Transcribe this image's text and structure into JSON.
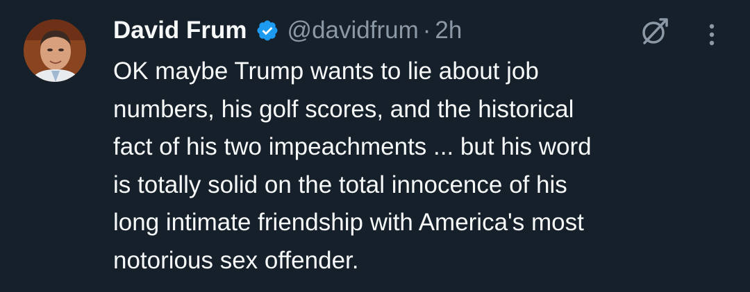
{
  "author": {
    "name": "David Frum",
    "handle": "@davidfrum",
    "separator": "·",
    "time": "2h",
    "verified": true
  },
  "tweet": {
    "lines": [
      "OK maybe Trump wants to lie about job",
      "numbers, his golf scores, and the historical",
      "fact of his two impeachments ... but his word",
      "is totally solid on the total innocence of his",
      "long intimate friendship with America's most",
      "notorious sex offender."
    ]
  },
  "icons": {
    "avatar": "avatar",
    "verified": "verified-badge-icon",
    "grok": "grok-icon",
    "more": "more-options-icon"
  },
  "colors": {
    "background": "#15202b",
    "text": "#f7f9f9",
    "secondary": "#8b98a5",
    "verified": "#1d9bf0"
  }
}
